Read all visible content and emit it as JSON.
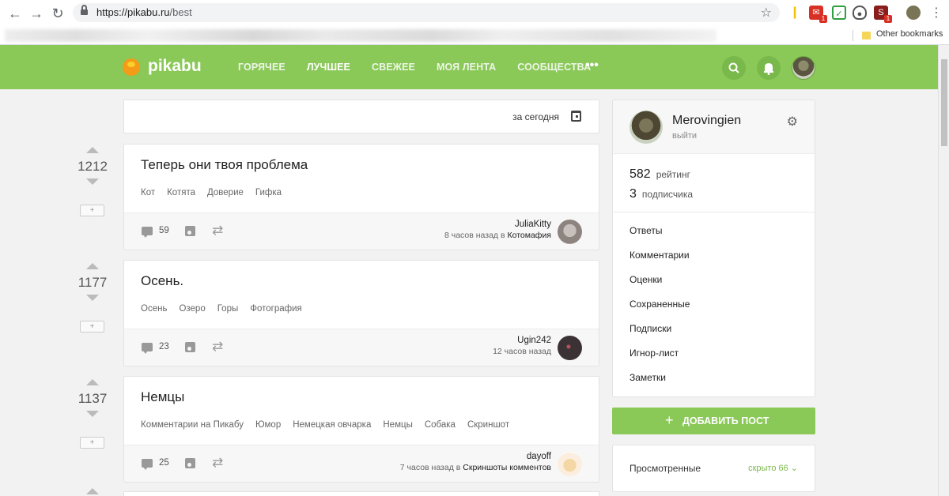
{
  "browser": {
    "url_host": "https://pikabu.ru",
    "url_path": "/best",
    "bookmark_label": "Other bookmarks",
    "extension_badges": [
      "1",
      "1"
    ]
  },
  "header": {
    "logo": "pikabu",
    "menu": [
      "ГОРЯЧЕЕ",
      "ЛУЧШЕЕ",
      "СВЕЖЕЕ",
      "МОЯ ЛЕНТА",
      "СООБЩЕСТВА"
    ],
    "active_menu": "ЛУЧШЕЕ",
    "more": "•••",
    "brand_color": "#8ac858"
  },
  "feed": {
    "filter_label": "за сегодня",
    "posts": [
      {
        "rating": "1212",
        "title": "Теперь они твоя проблема",
        "tags": [
          "Кот",
          "Котята",
          "Доверие",
          "Гифка"
        ],
        "comments": "59",
        "author": "JuliaKitty",
        "time": "8 часов назад в",
        "community": "Котомафия"
      },
      {
        "rating": "1177",
        "title": "Осень.",
        "tags": [
          "Осень",
          "Озеро",
          "Горы",
          "Фотография"
        ],
        "comments": "23",
        "author": "Ugin242",
        "time": "12 часов назад",
        "community": ""
      },
      {
        "rating": "1137",
        "title": "Немцы",
        "tags": [
          "Комментарии на Пикабу",
          "Юмор",
          "Немецкая овчарка",
          "Немцы",
          "Собака",
          "Скриншот"
        ],
        "comments": "25",
        "author": "dayoff",
        "time": "7 часов назад в",
        "community": "Скриншоты комментов"
      }
    ],
    "expand_label": "+"
  },
  "sidebar": {
    "username": "Merovingien",
    "logout": "выйти",
    "rating_value": "582",
    "rating_label": "рейтинг",
    "subscribers_value": "3",
    "subscribers_label": "подписчика",
    "links": [
      "Ответы",
      "Комментарии",
      "Оценки",
      "Сохраненные",
      "Подписки",
      "Игнор-лист",
      "Заметки"
    ],
    "add_post": "ДОБАВИТЬ ПОСТ",
    "viewed_label": "Просмотренные",
    "hidden_label": "скрыто 66 ⌄"
  }
}
